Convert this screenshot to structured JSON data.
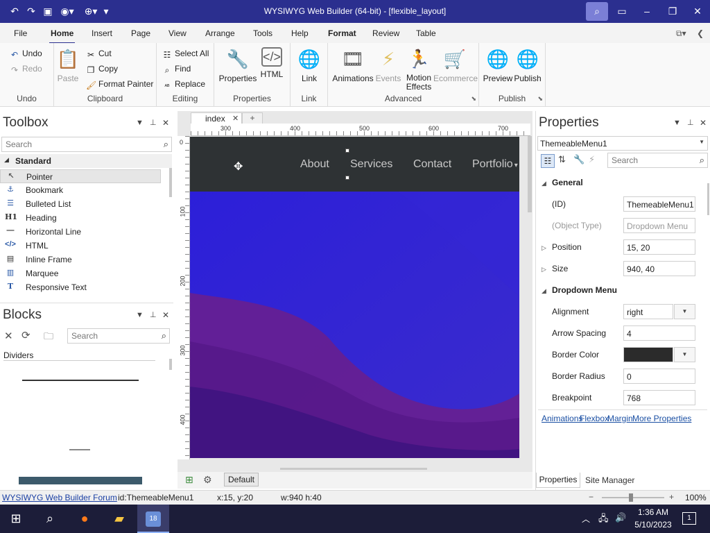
{
  "window": {
    "title": "WYSIWYG Web Builder (64-bit) - [flexible_layout]",
    "quick_access": [
      "undo-icon",
      "redo-icon",
      "save-icon",
      "preview-icon",
      "publish-icon",
      "customize-icon"
    ],
    "controls": {
      "minimize": "–",
      "maximize": "❐",
      "close": "✕"
    }
  },
  "menu": {
    "tabs": [
      {
        "label": "File"
      },
      {
        "label": "Home"
      },
      {
        "label": "Insert"
      },
      {
        "label": "Page"
      },
      {
        "label": "View"
      },
      {
        "label": "Arrange"
      },
      {
        "label": "Tools"
      },
      {
        "label": "Help"
      },
      {
        "label": "Format"
      },
      {
        "label": "Review"
      },
      {
        "label": "Table"
      }
    ],
    "selected": "Home"
  },
  "ribbon": {
    "undo": {
      "undo": "Undo",
      "redo": "Redo",
      "group": "Undo"
    },
    "clipboard": {
      "paste": "Paste",
      "cut": "Cut",
      "copy": "Copy",
      "format_painter": "Format Painter",
      "group": "Clipboard"
    },
    "editing": {
      "select_all": "Select All",
      "find": "Find",
      "replace": "Replace",
      "group": "Editing"
    },
    "properties": {
      "properties": "Properties",
      "html": "HTML",
      "group": "Properties"
    },
    "link": {
      "link": "Link",
      "group": "Link"
    },
    "advanced": {
      "animations": "Animations",
      "events": "Events",
      "motion_effects_1": "Motion",
      "motion_effects_2": "Effects",
      "ecommerce": "Ecommerce",
      "group": "Advanced"
    },
    "publish": {
      "preview": "Preview",
      "publish": "Publish",
      "group": "Publish"
    }
  },
  "toolbox": {
    "title": "Toolbox",
    "search_placeholder": "Search",
    "category": "Standard",
    "items": [
      {
        "label": "Pointer",
        "icon": "pointer-icon"
      },
      {
        "label": "Bookmark",
        "icon": "anchor-icon"
      },
      {
        "label": "Bulleted List",
        "icon": "list-icon"
      },
      {
        "label": "Heading",
        "icon": "heading-icon"
      },
      {
        "label": "Horizontal Line",
        "icon": "line-icon"
      },
      {
        "label": "HTML",
        "icon": "code-icon"
      },
      {
        "label": "Inline Frame",
        "icon": "frame-icon"
      },
      {
        "label": "Marquee",
        "icon": "marquee-icon"
      },
      {
        "label": "Responsive Text",
        "icon": "text-icon"
      }
    ]
  },
  "blocks": {
    "title": "Blocks",
    "search_placeholder": "Search",
    "category": "Dividers"
  },
  "document": {
    "tab": "index",
    "ruler_h": [
      "300",
      "400",
      "500",
      "600",
      "700"
    ],
    "ruler_v": [
      "0",
      "100",
      "200",
      "300",
      "400"
    ],
    "nav_links": [
      "About",
      "Services",
      "Contact",
      "Portfolio"
    ],
    "layout_button": "Default",
    "colors": {
      "navbar": "#2e3234",
      "hero_top": "#2a1fd8",
      "hero_bottom": "#6b1f8c"
    }
  },
  "properties": {
    "title": "Properties",
    "object": "ThemeableMenu1",
    "search_placeholder": "Search",
    "sections": [
      {
        "name": "General"
      },
      {
        "name": "Dropdown Menu"
      }
    ],
    "rows": {
      "id": {
        "label": "(ID)",
        "value": "ThemeableMenu1"
      },
      "object_type": {
        "label": "(Object Type)",
        "value": "Dropdown Menu"
      },
      "position": {
        "label": "Position",
        "value": "15, 20"
      },
      "size": {
        "label": "Size",
        "value": "940, 40"
      },
      "alignment": {
        "label": "Alignment",
        "value": "right"
      },
      "arrow_spacing": {
        "label": "Arrow Spacing",
        "value": "4"
      },
      "border_color": {
        "label": "Border Color",
        "value": "#2b2b2b"
      },
      "border_radius": {
        "label": "Border Radius",
        "value": "0"
      },
      "breakpoint": {
        "label": "Breakpoint",
        "value": "768"
      }
    },
    "links": [
      "Animations",
      "Flexbox",
      "Margin",
      "More Properties"
    ],
    "bottom_tabs": [
      "Properties",
      "Site Manager"
    ]
  },
  "status": {
    "forum": "WYSIWYG Web Builder Forum",
    "id": "id:ThemeableMenu1",
    "pos": "x:15, y:20",
    "size": "w:940 h:40",
    "zoom": "100%"
  },
  "taskbar": {
    "time": "1:36 AM",
    "date": "5/10/2023",
    "notif": "1"
  }
}
